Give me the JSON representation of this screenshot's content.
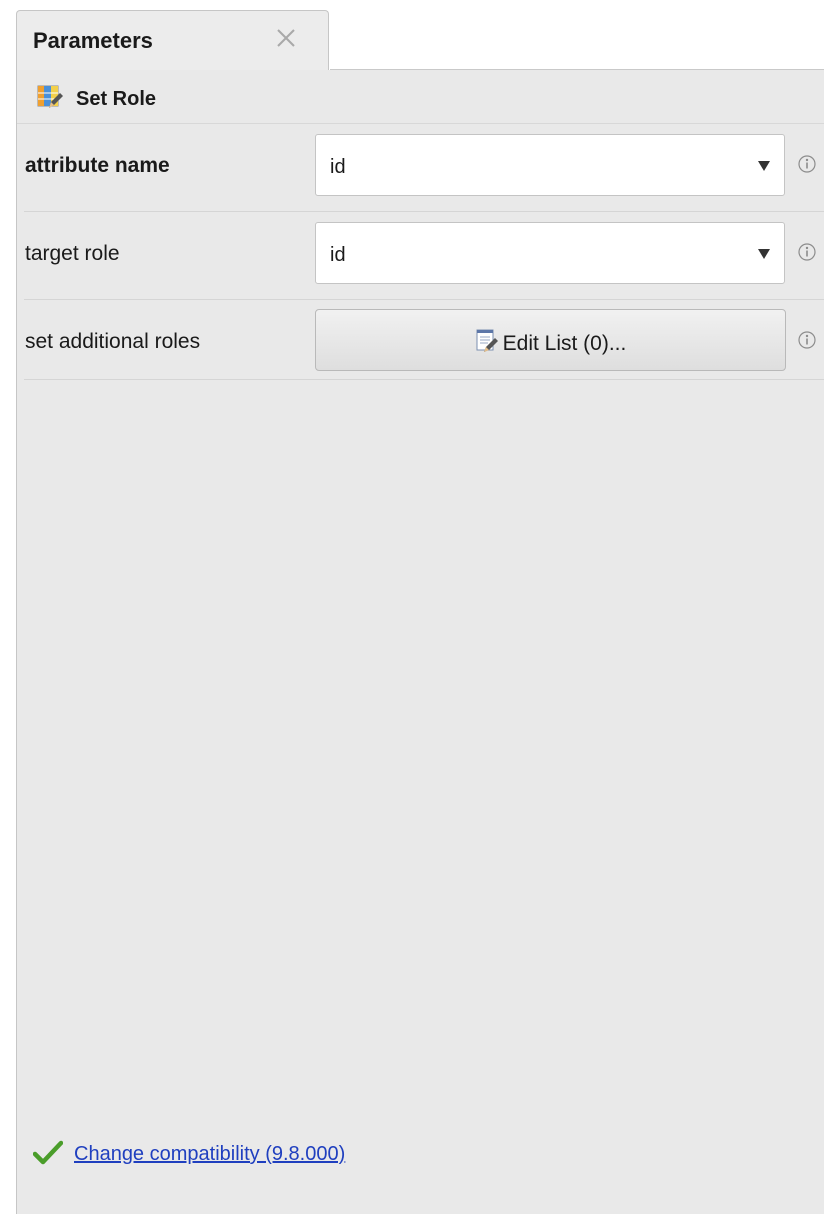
{
  "tab": {
    "title": "Parameters",
    "close_icon": "close-icon"
  },
  "operator": {
    "icon": "set-role-operator-icon",
    "title": "Set Role"
  },
  "parameters": [
    {
      "label": "attribute name",
      "label_bold": true,
      "type": "select",
      "value": "id"
    },
    {
      "label": "target role",
      "label_bold": false,
      "type": "select",
      "value": "id"
    },
    {
      "label": "set additional roles",
      "label_bold": false,
      "type": "button",
      "button_label": "Edit List (0)..."
    }
  ],
  "footer": {
    "link_text": "Change compatibility (9.8.000)",
    "icon": "check-icon"
  },
  "colors": {
    "panel_bg": "#e9e9e9",
    "link": "#1f3fbf",
    "check": "#4a9d2a"
  }
}
